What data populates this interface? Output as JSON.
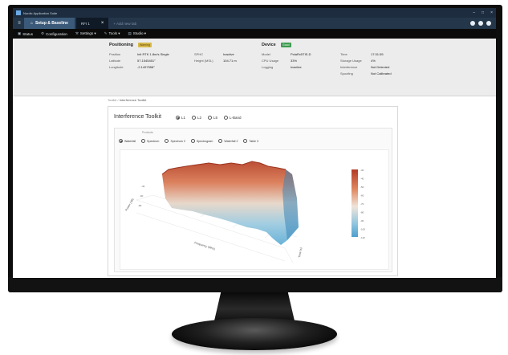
{
  "window": {
    "title": "Nordic Application Suite",
    "controls": [
      "–",
      "□",
      "×"
    ]
  },
  "tabs": {
    "main": {
      "label": "Setup & Baseline"
    },
    "doc": {
      "label": "RFI 1",
      "close": "×"
    },
    "add": {
      "label": "+  Add new tab"
    }
  },
  "menu": [
    {
      "icon": "▣",
      "label": "Status"
    },
    {
      "icon": "⚙",
      "label": "Configuration"
    },
    {
      "icon": "⚒",
      "label": "Settings ▾"
    },
    {
      "icon": "✎",
      "label": "Tools ▾"
    },
    {
      "icon": "▤",
      "label": "Studio ▾"
    }
  ],
  "positioning": {
    "title": "Positioning",
    "badge": "Warning",
    "labels": [
      "Position",
      "Latitude",
      "Longitude"
    ],
    "values": [
      "Init  RTK  1.8m/s  Single",
      "57.1545451°",
      "-2.1497558°"
    ],
    "extra_labels": [
      "SPHC",
      "Height (MSL)"
    ],
    "extra_values": [
      "Inactive",
      "104.71 m"
    ]
  },
  "device": {
    "title": "Device",
    "badge": "Good",
    "labels": [
      "Model",
      "CPU Usage",
      "Logging"
    ],
    "values": [
      "PolaRx5TIS-D",
      "33%",
      "Inactive"
    ],
    "labels2": [
      "Time",
      "Storage Usage",
      "Interference",
      "Spoofing"
    ],
    "values2": [
      "17:31:55",
      "4%",
      "Not Detected",
      "Not Calibrated"
    ]
  },
  "breadcrumb": {
    "parent": "Toolkit / ",
    "current": "Interference Toolkit"
  },
  "toolkit": {
    "title": "Interference Toolkit",
    "bands": [
      "L1",
      "L2",
      "L5",
      "L-Band"
    ],
    "products_label": "Products",
    "products": [
      "Waterfall",
      "Spectrum",
      "Spectrum 2",
      "Spectrogram",
      "Waterfall 2",
      "Table 3"
    ],
    "colorbar_ticks": [
      "-30",
      "-40",
      "-50",
      "-60",
      "-70",
      "-80",
      "-90",
      "-100",
      "-110"
    ],
    "x_axis_label": "Frequency (MHz)",
    "y_axis_label": "Time (s)",
    "z_axis_label": "Power (dB)"
  },
  "colors": {
    "accent": "#3b5a7a",
    "warning": "#d7b84a",
    "good": "#3e9a50",
    "chart_high": "#c5552f",
    "chart_low": "#6fb3d8"
  }
}
